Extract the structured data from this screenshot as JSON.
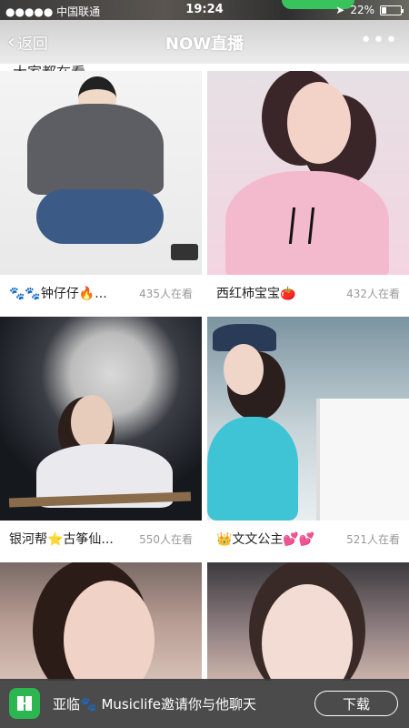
{
  "status_bar": {
    "carrier": "●●●●● 中国联通",
    "wifi_icon": "wifi-icon",
    "time": "19:24",
    "location_icon": "location-arrow-icon",
    "battery_percent": "22%",
    "battery_level": 0.22
  },
  "nav": {
    "back_label": "返回",
    "title": "NOW直播",
    "more_label": "•••",
    "section_heading": "大家都在看"
  },
  "streams": [
    {
      "name": "🐾🐾钟仔仔🔥...",
      "viewers": "435人在看"
    },
    {
      "name": "西红柿宝宝🍅",
      "viewers": "432人在看"
    },
    {
      "name": "银河帮⭐古筝仙...",
      "viewers": "550人在看"
    },
    {
      "name": "👑文文公主💕💕",
      "viewers": "521人在看"
    },
    {
      "name": "",
      "viewers": ""
    },
    {
      "name": "",
      "viewers": ""
    }
  ],
  "bottom_bar": {
    "invite_text": "亚临🐾 Musiclife邀请你与他聊天",
    "download_label": "下载",
    "brand_color": "#2bb64f"
  }
}
